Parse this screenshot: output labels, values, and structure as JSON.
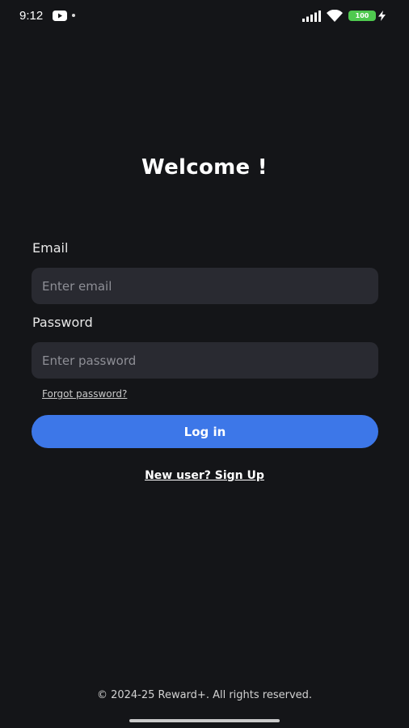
{
  "status_bar": {
    "time": "9:12",
    "battery_level": "100",
    "icons": [
      "youtube-icon",
      "notification-dot-icon",
      "signal-icon",
      "wifi-icon",
      "battery-icon",
      "charging-icon"
    ]
  },
  "login": {
    "title": "Welcome !",
    "email_label": "Email",
    "email_placeholder": "Enter email",
    "email_value": "",
    "password_label": "Password",
    "password_placeholder": "Enter password",
    "password_value": "",
    "forgot_password": "Forgot password?",
    "login_button": "Log in",
    "signup_link": "New user? Sign Up"
  },
  "footer": {
    "copyright": "© 2024-25 Reward+. All rights reserved."
  },
  "colors": {
    "background": "#141518",
    "input_background": "#292a31",
    "accent": "#3d77e8",
    "battery": "#4fc94f"
  }
}
